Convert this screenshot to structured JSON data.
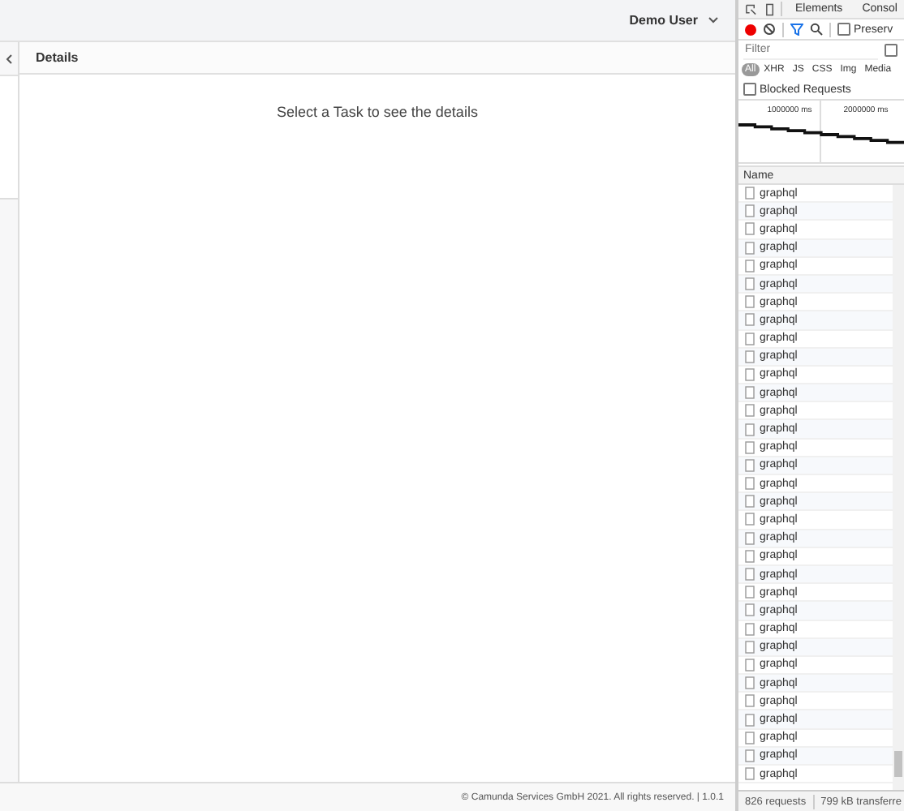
{
  "app": {
    "user_menu": {
      "label": "Demo User"
    },
    "details": {
      "title": "Details",
      "empty_message": "Select a Task to see the details"
    },
    "footer": "© Camunda Services GmbH 2021. All rights reserved. | 1.0.1"
  },
  "devtools": {
    "tabs": [
      {
        "label": "Elements",
        "selected": false
      },
      {
        "label": "Consol",
        "selected": false
      }
    ],
    "toolbar": {
      "recording": true,
      "preserve_log": {
        "label": "Preserv",
        "checked": false
      }
    },
    "filter": {
      "placeholder": "Filter",
      "option_checked": false
    },
    "type_filters": [
      {
        "label": "All",
        "selected": true
      },
      {
        "label": "XHR",
        "selected": false
      },
      {
        "label": "JS",
        "selected": false
      },
      {
        "label": "CSS",
        "selected": false
      },
      {
        "label": "Img",
        "selected": false
      },
      {
        "label": "Media",
        "selected": false
      }
    ],
    "blocked_requests": {
      "label": "Blocked Requests",
      "checked": false
    },
    "overview": {
      "ticks": [
        "1000000 ms",
        "2000000 ms"
      ]
    },
    "table": {
      "column": "Name",
      "rows": [
        {
          "name": "graphql"
        },
        {
          "name": "graphql"
        },
        {
          "name": "graphql"
        },
        {
          "name": "graphql"
        },
        {
          "name": "graphql"
        },
        {
          "name": "graphql"
        },
        {
          "name": "graphql"
        },
        {
          "name": "graphql"
        },
        {
          "name": "graphql"
        },
        {
          "name": "graphql"
        },
        {
          "name": "graphql"
        },
        {
          "name": "graphql"
        },
        {
          "name": "graphql"
        },
        {
          "name": "graphql"
        },
        {
          "name": "graphql"
        },
        {
          "name": "graphql"
        },
        {
          "name": "graphql"
        },
        {
          "name": "graphql"
        },
        {
          "name": "graphql"
        },
        {
          "name": "graphql"
        },
        {
          "name": "graphql"
        },
        {
          "name": "graphql"
        },
        {
          "name": "graphql"
        },
        {
          "name": "graphql"
        },
        {
          "name": "graphql"
        },
        {
          "name": "graphql"
        },
        {
          "name": "graphql"
        },
        {
          "name": "graphql"
        },
        {
          "name": "graphql"
        },
        {
          "name": "graphql"
        },
        {
          "name": "graphql"
        },
        {
          "name": "graphql"
        },
        {
          "name": "graphql"
        }
      ]
    },
    "status_bar": {
      "requests": "826 requests",
      "transferred": "799 kB transferre"
    }
  }
}
